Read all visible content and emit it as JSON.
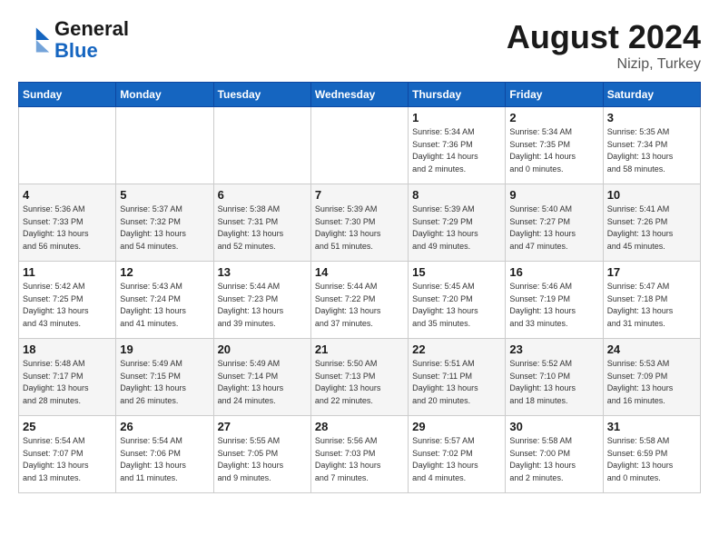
{
  "header": {
    "logo_line1": "General",
    "logo_line2": "Blue",
    "month": "August 2024",
    "location": "Nizip, Turkey"
  },
  "weekdays": [
    "Sunday",
    "Monday",
    "Tuesday",
    "Wednesday",
    "Thursday",
    "Friday",
    "Saturday"
  ],
  "weeks": [
    [
      {
        "day": "",
        "info": ""
      },
      {
        "day": "",
        "info": ""
      },
      {
        "day": "",
        "info": ""
      },
      {
        "day": "",
        "info": ""
      },
      {
        "day": "1",
        "info": "Sunrise: 5:34 AM\nSunset: 7:36 PM\nDaylight: 14 hours\nand 2 minutes."
      },
      {
        "day": "2",
        "info": "Sunrise: 5:34 AM\nSunset: 7:35 PM\nDaylight: 14 hours\nand 0 minutes."
      },
      {
        "day": "3",
        "info": "Sunrise: 5:35 AM\nSunset: 7:34 PM\nDaylight: 13 hours\nand 58 minutes."
      }
    ],
    [
      {
        "day": "4",
        "info": "Sunrise: 5:36 AM\nSunset: 7:33 PM\nDaylight: 13 hours\nand 56 minutes."
      },
      {
        "day": "5",
        "info": "Sunrise: 5:37 AM\nSunset: 7:32 PM\nDaylight: 13 hours\nand 54 minutes."
      },
      {
        "day": "6",
        "info": "Sunrise: 5:38 AM\nSunset: 7:31 PM\nDaylight: 13 hours\nand 52 minutes."
      },
      {
        "day": "7",
        "info": "Sunrise: 5:39 AM\nSunset: 7:30 PM\nDaylight: 13 hours\nand 51 minutes."
      },
      {
        "day": "8",
        "info": "Sunrise: 5:39 AM\nSunset: 7:29 PM\nDaylight: 13 hours\nand 49 minutes."
      },
      {
        "day": "9",
        "info": "Sunrise: 5:40 AM\nSunset: 7:27 PM\nDaylight: 13 hours\nand 47 minutes."
      },
      {
        "day": "10",
        "info": "Sunrise: 5:41 AM\nSunset: 7:26 PM\nDaylight: 13 hours\nand 45 minutes."
      }
    ],
    [
      {
        "day": "11",
        "info": "Sunrise: 5:42 AM\nSunset: 7:25 PM\nDaylight: 13 hours\nand 43 minutes."
      },
      {
        "day": "12",
        "info": "Sunrise: 5:43 AM\nSunset: 7:24 PM\nDaylight: 13 hours\nand 41 minutes."
      },
      {
        "day": "13",
        "info": "Sunrise: 5:44 AM\nSunset: 7:23 PM\nDaylight: 13 hours\nand 39 minutes."
      },
      {
        "day": "14",
        "info": "Sunrise: 5:44 AM\nSunset: 7:22 PM\nDaylight: 13 hours\nand 37 minutes."
      },
      {
        "day": "15",
        "info": "Sunrise: 5:45 AM\nSunset: 7:20 PM\nDaylight: 13 hours\nand 35 minutes."
      },
      {
        "day": "16",
        "info": "Sunrise: 5:46 AM\nSunset: 7:19 PM\nDaylight: 13 hours\nand 33 minutes."
      },
      {
        "day": "17",
        "info": "Sunrise: 5:47 AM\nSunset: 7:18 PM\nDaylight: 13 hours\nand 31 minutes."
      }
    ],
    [
      {
        "day": "18",
        "info": "Sunrise: 5:48 AM\nSunset: 7:17 PM\nDaylight: 13 hours\nand 28 minutes."
      },
      {
        "day": "19",
        "info": "Sunrise: 5:49 AM\nSunset: 7:15 PM\nDaylight: 13 hours\nand 26 minutes."
      },
      {
        "day": "20",
        "info": "Sunrise: 5:49 AM\nSunset: 7:14 PM\nDaylight: 13 hours\nand 24 minutes."
      },
      {
        "day": "21",
        "info": "Sunrise: 5:50 AM\nSunset: 7:13 PM\nDaylight: 13 hours\nand 22 minutes."
      },
      {
        "day": "22",
        "info": "Sunrise: 5:51 AM\nSunset: 7:11 PM\nDaylight: 13 hours\nand 20 minutes."
      },
      {
        "day": "23",
        "info": "Sunrise: 5:52 AM\nSunset: 7:10 PM\nDaylight: 13 hours\nand 18 minutes."
      },
      {
        "day": "24",
        "info": "Sunrise: 5:53 AM\nSunset: 7:09 PM\nDaylight: 13 hours\nand 16 minutes."
      }
    ],
    [
      {
        "day": "25",
        "info": "Sunrise: 5:54 AM\nSunset: 7:07 PM\nDaylight: 13 hours\nand 13 minutes."
      },
      {
        "day": "26",
        "info": "Sunrise: 5:54 AM\nSunset: 7:06 PM\nDaylight: 13 hours\nand 11 minutes."
      },
      {
        "day": "27",
        "info": "Sunrise: 5:55 AM\nSunset: 7:05 PM\nDaylight: 13 hours\nand 9 minutes."
      },
      {
        "day": "28",
        "info": "Sunrise: 5:56 AM\nSunset: 7:03 PM\nDaylight: 13 hours\nand 7 minutes."
      },
      {
        "day": "29",
        "info": "Sunrise: 5:57 AM\nSunset: 7:02 PM\nDaylight: 13 hours\nand 4 minutes."
      },
      {
        "day": "30",
        "info": "Sunrise: 5:58 AM\nSunset: 7:00 PM\nDaylight: 13 hours\nand 2 minutes."
      },
      {
        "day": "31",
        "info": "Sunrise: 5:58 AM\nSunset: 6:59 PM\nDaylight: 13 hours\nand 0 minutes."
      }
    ]
  ]
}
